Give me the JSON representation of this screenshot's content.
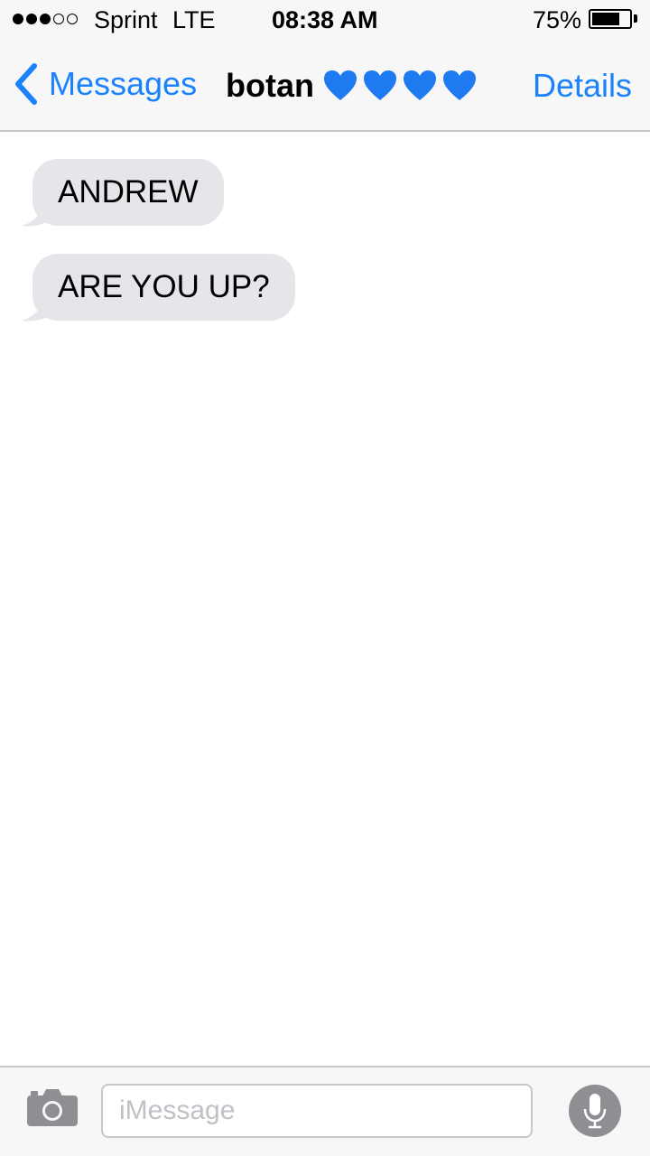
{
  "status_bar": {
    "signal_filled": 3,
    "signal_total": 5,
    "carrier": "Sprint",
    "network": "LTE",
    "time": "08:38 AM",
    "battery_percent_label": "75%",
    "battery_level": 0.75
  },
  "nav": {
    "back_label": "Messages",
    "contact_name": "botan",
    "contact_emoji": [
      "blue-heart",
      "blue-heart",
      "blue-heart",
      "blue-heart"
    ],
    "details_label": "Details"
  },
  "messages": [
    {
      "direction": "incoming",
      "text": "ANDREW"
    },
    {
      "direction": "incoming",
      "text": "ARE YOU UP?"
    }
  ],
  "input_bar": {
    "placeholder": "iMessage",
    "value": "",
    "left_icon": "camera-icon",
    "right_icon": "microphone-icon"
  },
  "colors": {
    "accent": "#1a82fb",
    "incoming_bubble": "#e5e5ea",
    "bar_background": "#f7f7f7",
    "heart": "#1e7af0"
  }
}
